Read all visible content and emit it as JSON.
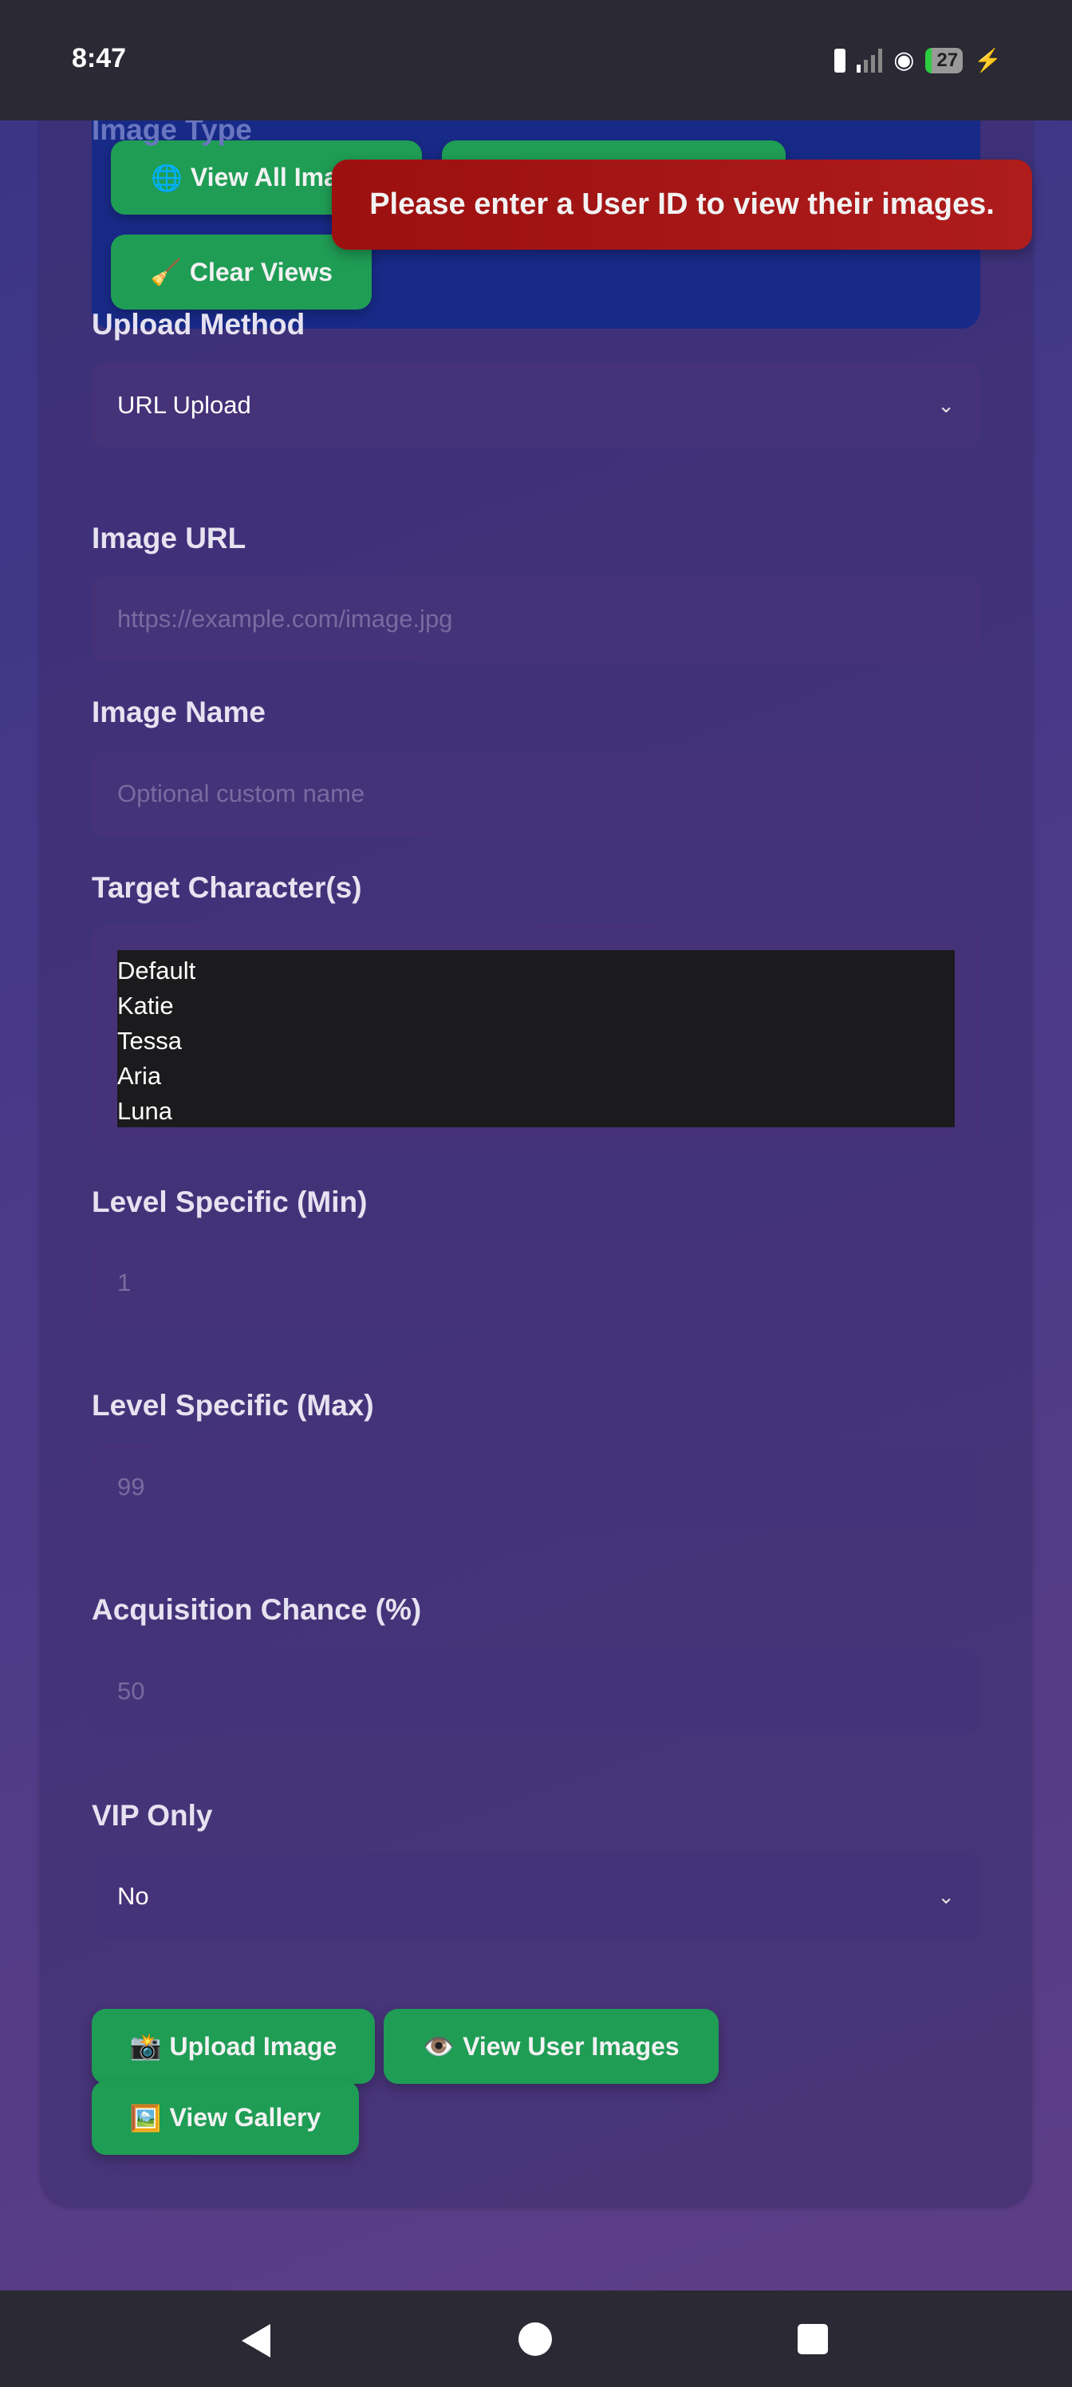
{
  "status": {
    "time": "8:47",
    "battery": "27"
  },
  "panel": {
    "label": "Image Type",
    "view_all": "View All Images",
    "clear_views": "Clear Views"
  },
  "toast": "Please enter a User ID to view their images.",
  "form": {
    "upload_method": {
      "label": "Upload Method",
      "value": "URL Upload"
    },
    "image_url": {
      "label": "Image URL",
      "placeholder": "https://example.com/image.jpg"
    },
    "image_name": {
      "label": "Image Name",
      "placeholder": "Optional custom name"
    },
    "characters": {
      "label": "Target Character(s)",
      "options": [
        "Default",
        "Katie",
        "Tessa",
        "Aria",
        "Luna"
      ]
    },
    "level_min": {
      "label": "Level Specific (Min)",
      "placeholder": "1"
    },
    "level_max": {
      "label": "Level Specific (Max)",
      "placeholder": "99"
    },
    "chance": {
      "label": "Acquisition Chance (%)",
      "placeholder": "50"
    },
    "vip": {
      "label": "VIP Only",
      "value": "No"
    }
  },
  "actions": {
    "upload": "Upload Image",
    "view_user": "View User Images",
    "gallery": "View Gallery"
  },
  "icons": {
    "globe": "🌐",
    "broom": "🧹",
    "camera": "📸",
    "eye": "👁️",
    "picture": "🖼️"
  }
}
